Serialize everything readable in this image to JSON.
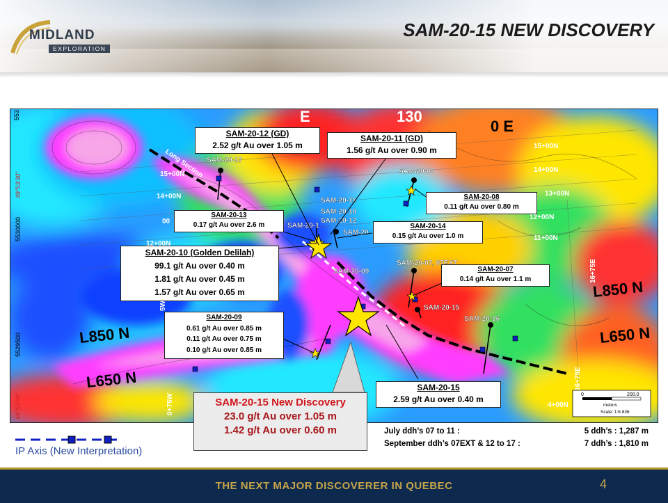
{
  "header": {
    "logo_word": "MIDLAND",
    "logo_sub": "EXPLORATION",
    "title": "SAM-20-15 NEW DISCOVERY"
  },
  "map": {
    "coords": {
      "easting_top": "553",
      "northing_1": "5530000",
      "northing_2": "5529500",
      "lat_1": "49°53'30\"",
      "lat_2": "49°53'00\""
    },
    "grid_labels": [
      "15+00N",
      "14+00N",
      "13+00N",
      "12+00N",
      "11+00N",
      "15+00N",
      "14+00N",
      "13+00N",
      "12+00N",
      "11+00N",
      "16+75E",
      "16+75E",
      "4+00N",
      "0+75W",
      "5W",
      "130",
      "0 E",
      "E",
      "00"
    ],
    "line_labels": [
      "L850 N",
      "L650 N",
      "L850 N",
      "L650 N"
    ],
    "long_section": "Long Section",
    "holes": [
      "SAM-20-17",
      "SAM-20-08",
      "SAM-20-11",
      "SAM-20-10",
      "SAM-20-12",
      "SAM-20-1",
      "SAM-20",
      "SAM-20-09",
      "SAM-20-07, 07EXT",
      "SAM-20-15",
      "SAM-20-16"
    ],
    "scale": {
      "zero": "0",
      "max": "200.0",
      "unit": "meters",
      "ratio": "Scale: 1:6 836"
    },
    "colors": {
      "magenta": "#ff3cff",
      "pink": "#f7a6e8",
      "red": "#ff2020",
      "yellow": "#ffe600",
      "green": "#00d040",
      "cyan": "#20e8ff",
      "blue": "#1040ff"
    }
  },
  "callouts": {
    "sam12": {
      "title": "SAM-20-12 (GD)",
      "lines": [
        "2.52 g/t Au over 1.05 m"
      ]
    },
    "sam11": {
      "title": "SAM-20-11 (GD)",
      "lines": [
        "1.56 g/t Au over 0.90 m"
      ]
    },
    "sam08": {
      "title": "SAM-20-08",
      "lines": [
        "0.11 g/t Au over 0.80 m"
      ]
    },
    "sam13": {
      "title": "SAM-20-13",
      "lines": [
        "0.17 g/t Au over 2.6 m"
      ]
    },
    "sam14": {
      "title": "SAM-20-14",
      "lines": [
        "0.15 g/t Au over 1.0 m"
      ]
    },
    "sam10": {
      "title": "SAM-20-10 (Golden Delilah)",
      "lines": [
        "99.1 g/t Au over 0.40 m",
        "1.81 g/t Au over 0.45 m",
        "1.57 g/t Au over 0.65 m"
      ]
    },
    "sam07": {
      "title": "SAM-20-07",
      "lines": [
        "0.14 g/t Au over 1.1 m"
      ]
    },
    "sam09": {
      "title": "SAM-20-09",
      "lines": [
        "0.61 g/t Au over 0.85 m",
        "0.11 g/t Au over 0.75 m",
        "0.10 g/t Au over 0.85 m"
      ]
    },
    "sam15": {
      "title": "SAM-20-15",
      "lines": [
        "2.59 g/t Au over 0.40 m"
      ]
    }
  },
  "discovery": {
    "title": "SAM-20-15 New Discovery",
    "line1": "23.0 g/t Au over 1.05 m",
    "line2": "1.42 g/t Au over 0.60 m"
  },
  "legend": {
    "label": "IP Axis (New Interpretation)",
    "line_color": "#1020c0"
  },
  "ddh": {
    "row1_left": "July ddh’s 07 to 11 :",
    "row1_right": "5 ddh’s : 1,287 m",
    "row2_left": "September ddh’s 07EXT & 12 to 17 :",
    "row2_right": "7 ddh’s : 1,810 m"
  },
  "footer": {
    "text": "THE NEXT MAJOR DISCOVERER IN QUEBEC",
    "page": "4",
    "bg": "#0d2a4e",
    "accent": "#c7a548"
  }
}
